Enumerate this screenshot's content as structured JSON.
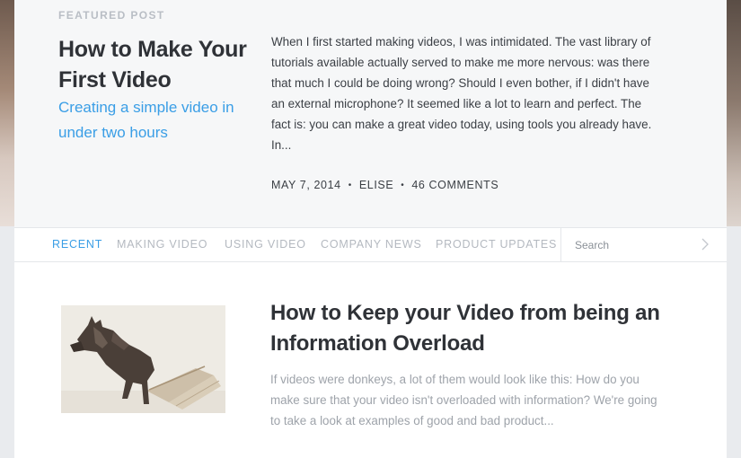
{
  "featured": {
    "label": "FEATURED POST",
    "title": "How to Make Your First Video",
    "subtitle": "Creating a simple video in under two hours",
    "excerpt": "When I first started making videos, I was intimidated. The vast library of tutorials available actually served to make me more nervous: was there that much I could be doing wrong? Should I even bother, if I didn't have an external microphone? It seemed like a lot to learn and perfect. The fact is: you can make a great video today, using tools you already have. In...",
    "date": "MAY 7, 2014",
    "author": "ELISE",
    "comments": "46 COMMENTS",
    "separator": "•"
  },
  "nav": {
    "tabs": [
      {
        "label": "RECENT",
        "active": true
      },
      {
        "label": "MAKING VIDEO",
        "active": false
      },
      {
        "label": "USING VIDEO",
        "active": false
      },
      {
        "label": "COMPANY NEWS",
        "active": false
      },
      {
        "label": "PRODUCT UPDATES",
        "active": false
      }
    ],
    "search_placeholder": "Search",
    "search_icon": "chevron-right-icon"
  },
  "post": {
    "title": "How to Keep your Video from being an Information Overload",
    "excerpt": "If videos were donkeys, a lot of them would look like this: How do you make sure that your video isn't overloaded with information? We're going to take a look at examples of good and bad product...",
    "image": "donkey-photo"
  },
  "colors": {
    "accent": "#3a9ee6",
    "title_text": "#2f3237",
    "muted_text": "#b4b9c0"
  }
}
